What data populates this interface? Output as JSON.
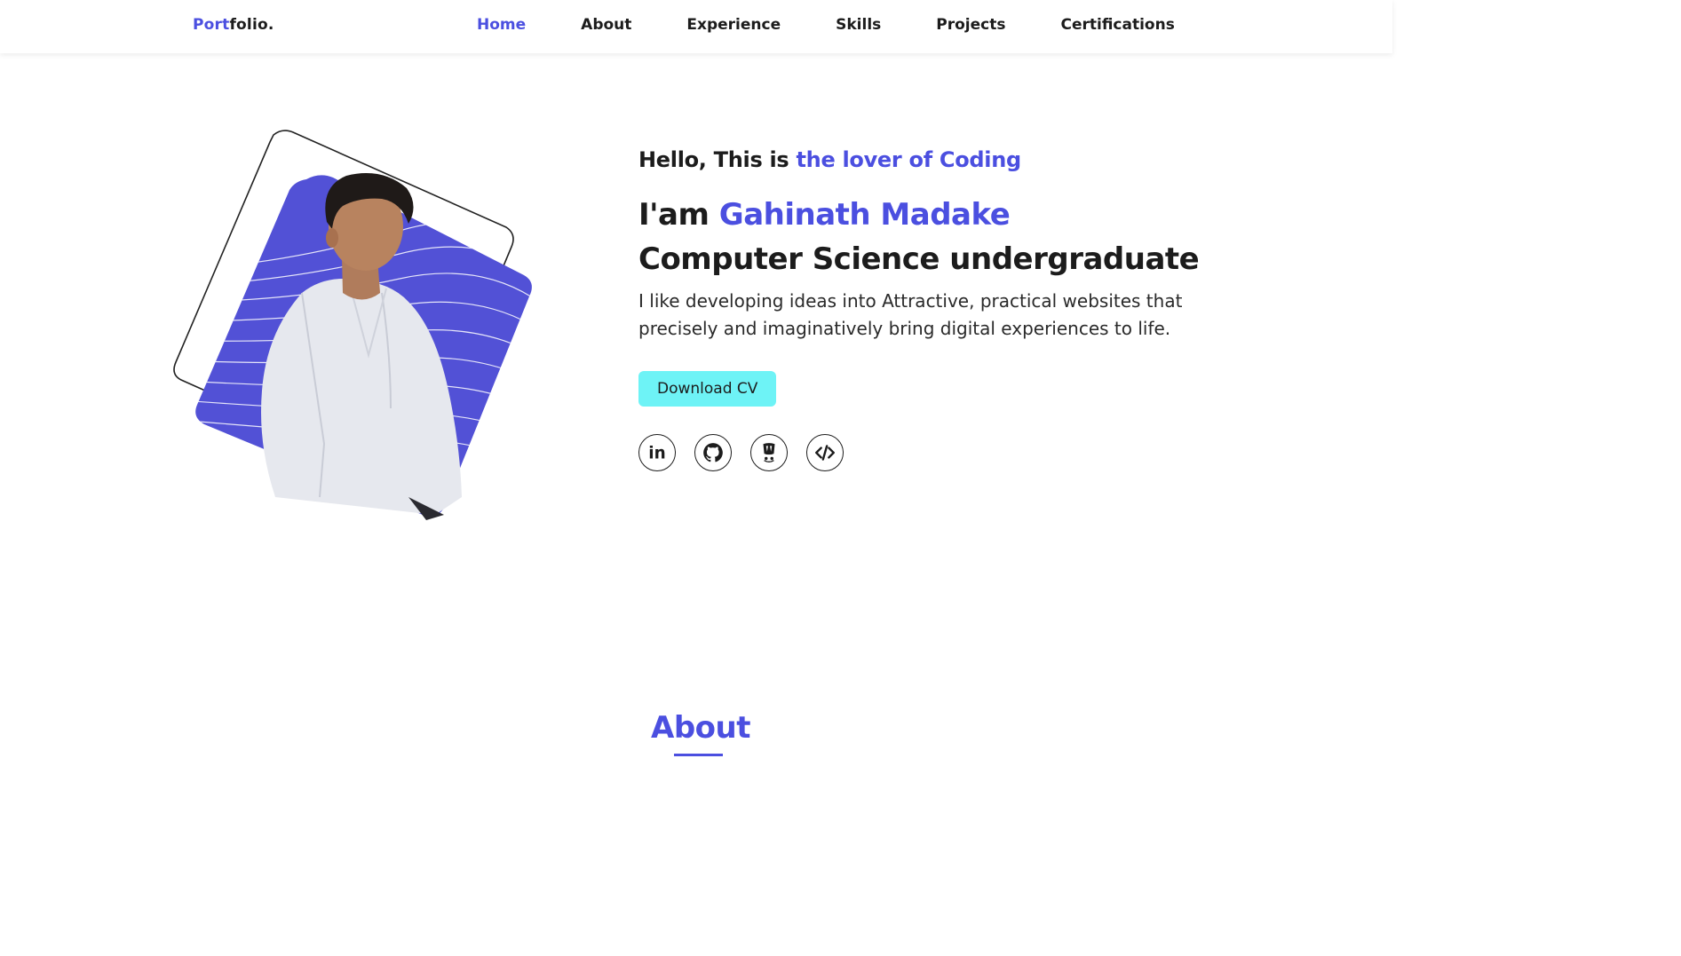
{
  "brand": {
    "logo_accent": "Port",
    "logo_rest": "folio."
  },
  "nav": {
    "items": [
      {
        "label": "Home",
        "active": true
      },
      {
        "label": "About",
        "active": false
      },
      {
        "label": "Experience",
        "active": false
      },
      {
        "label": "Skills",
        "active": false
      },
      {
        "label": "Projects",
        "active": false
      },
      {
        "label": "Certifications",
        "active": false
      }
    ]
  },
  "hero": {
    "greeting_prefix": "Hello, This is ",
    "greeting_accent": "the lover of Coding",
    "name_prefix": "I'am ",
    "name": "Gahinath Madake",
    "role": "Computer Science undergraduate",
    "bio": "I like developing ideas into Attractive, practical websites that precisely and imaginatively bring digital experiences to life.",
    "cv_button": "Download CV",
    "socials": [
      {
        "icon": "linkedin-icon"
      },
      {
        "icon": "github-icon"
      },
      {
        "icon": "coding-profile-icon"
      },
      {
        "icon": "code-icon"
      }
    ]
  },
  "about": {
    "title": "About"
  },
  "colors": {
    "accent": "#4b4fe0",
    "button": "#6ef3f6",
    "text": "#1c1c1c"
  }
}
